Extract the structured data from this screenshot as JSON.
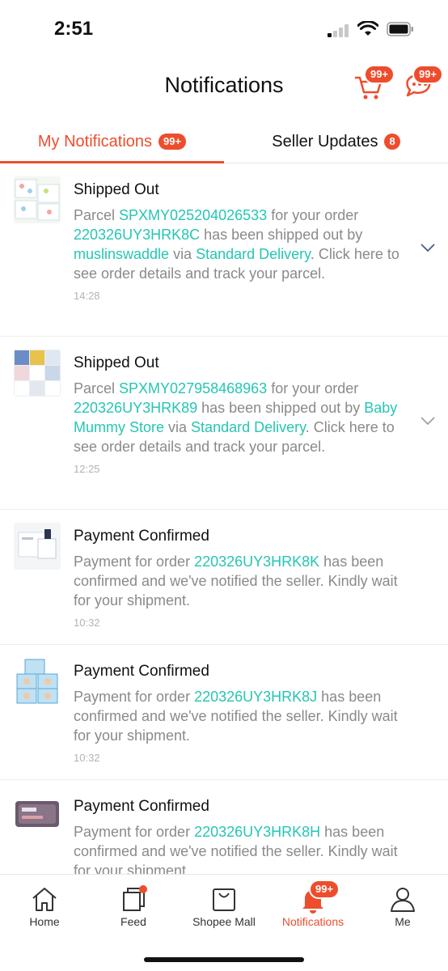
{
  "status": {
    "time": "2:51"
  },
  "header": {
    "title": "Notifications",
    "cart_badge": "99+",
    "chat_badge": "99+"
  },
  "tabs": [
    {
      "label": "My Notifications",
      "badge": "99+"
    },
    {
      "label": "Seller Updates",
      "badge": "8"
    }
  ],
  "notifications": [
    {
      "title": "Shipped Out",
      "body": [
        {
          "t": "Parcel "
        },
        {
          "t": "SPXMY025204026533",
          "link": true
        },
        {
          "t": " for your order "
        },
        {
          "t": "220326UY3HRK8C",
          "link": true
        },
        {
          "t": " has been shipped out by "
        },
        {
          "t": "muslinswaddle",
          "link": true
        },
        {
          "t": " via "
        },
        {
          "t": "Standard Delivery",
          "link": true
        },
        {
          "t": ". Click here to see order details and track your parcel."
        }
      ],
      "time": "14:28",
      "expandable": true
    },
    {
      "title": "Shipped Out",
      "body": [
        {
          "t": "Parcel "
        },
        {
          "t": "SPXMY027958468963",
          "link": true
        },
        {
          "t": " for your order "
        },
        {
          "t": "220326UY3HRK89",
          "link": true
        },
        {
          "t": " has been shipped out by "
        },
        {
          "t": "Baby Mummy Store",
          "link": true
        },
        {
          "t": " via "
        },
        {
          "t": "Standard Delivery",
          "link": true
        },
        {
          "t": ". Click here to see order details and track your parcel."
        }
      ],
      "time": "12:25",
      "expandable": true
    },
    {
      "title": "Payment Confirmed",
      "body": [
        {
          "t": "Payment for order "
        },
        {
          "t": "220326UY3HRK8K",
          "link": true
        },
        {
          "t": " has been confirmed and we've notified the seller. Kindly wait for your shipment."
        }
      ],
      "time": "10:32",
      "expandable": false
    },
    {
      "title": "Payment Confirmed",
      "body": [
        {
          "t": "Payment for order "
        },
        {
          "t": "220326UY3HRK8J",
          "link": true
        },
        {
          "t": " has been confirmed and we've notified the seller. Kindly wait for your shipment."
        }
      ],
      "time": "10:32",
      "expandable": false
    },
    {
      "title": "Payment Confirmed",
      "body": [
        {
          "t": "Payment for order "
        },
        {
          "t": "220326UY3HRK8H",
          "link": true
        },
        {
          "t": " has been confirmed and we've notified the seller. Kindly wait for your shipment."
        }
      ],
      "time": "",
      "expandable": false
    }
  ],
  "bottom_nav": [
    {
      "label": "Home",
      "icon": "home-icon",
      "active": false
    },
    {
      "label": "Feed",
      "icon": "feed-icon",
      "active": false
    },
    {
      "label": "Shopee Mall",
      "icon": "mall-bag-icon",
      "active": false
    },
    {
      "label": "Notifications",
      "icon": "bell-icon",
      "active": true,
      "badge": "99+"
    },
    {
      "label": "Me",
      "icon": "user-icon",
      "active": false
    }
  ],
  "colors": {
    "accent": "#ee4d2d",
    "link": "#26c6b2",
    "body_text": "#8a8a8a"
  }
}
